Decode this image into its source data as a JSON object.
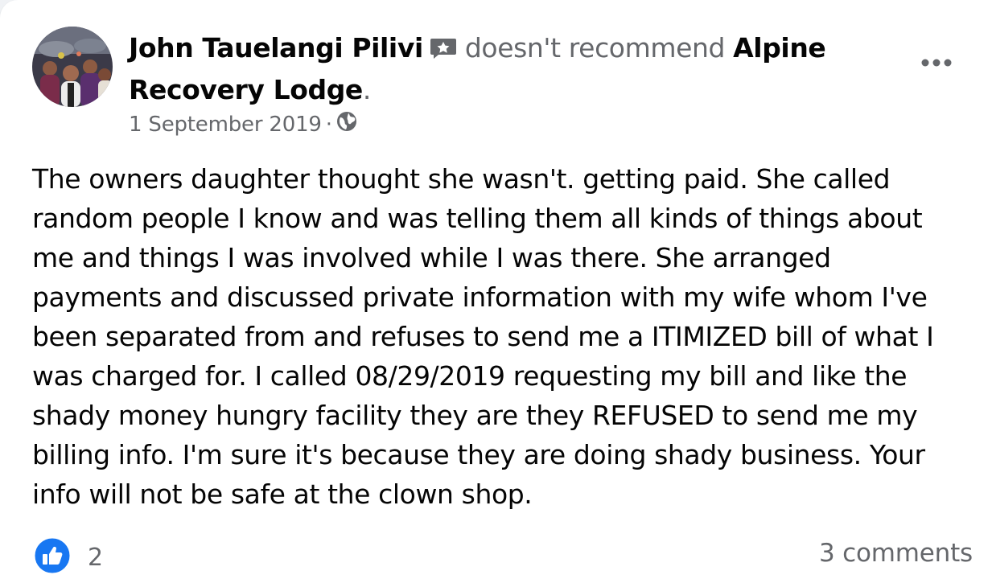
{
  "post": {
    "author": "John Tauelangi Pilivi",
    "verb": "doesn't recommend",
    "page_name": "Alpine Recovery Lodge",
    "period": ".",
    "date": "1 September 2019",
    "separator": "·",
    "privacy_icon": "globe-icon",
    "badge_icon": "review-badge-icon",
    "more_icon": "more-horizontal-icon",
    "body": "The owners daughter thought she wasn't. getting paid. She called random people I know and was telling them all kinds of things about me and things I was involved while I was there. She arranged payments and discussed private information with my wife whom I've been separated from and refuses to send me a ITIMIZED bill of what I was charged for. I called 08/29/2019 requesting my bill and like the shady money hungry facility they are they REFUSED to send me my billing info. I'm sure it's because they are doing shady business. Your info will not be safe at the clown shop."
  },
  "footer": {
    "reaction_icon": "like-icon",
    "reaction_count": "2",
    "comments": "3 comments"
  },
  "colors": {
    "text_primary": "#050505",
    "text_secondary": "#65676b",
    "like_blue": "#1877f2"
  }
}
